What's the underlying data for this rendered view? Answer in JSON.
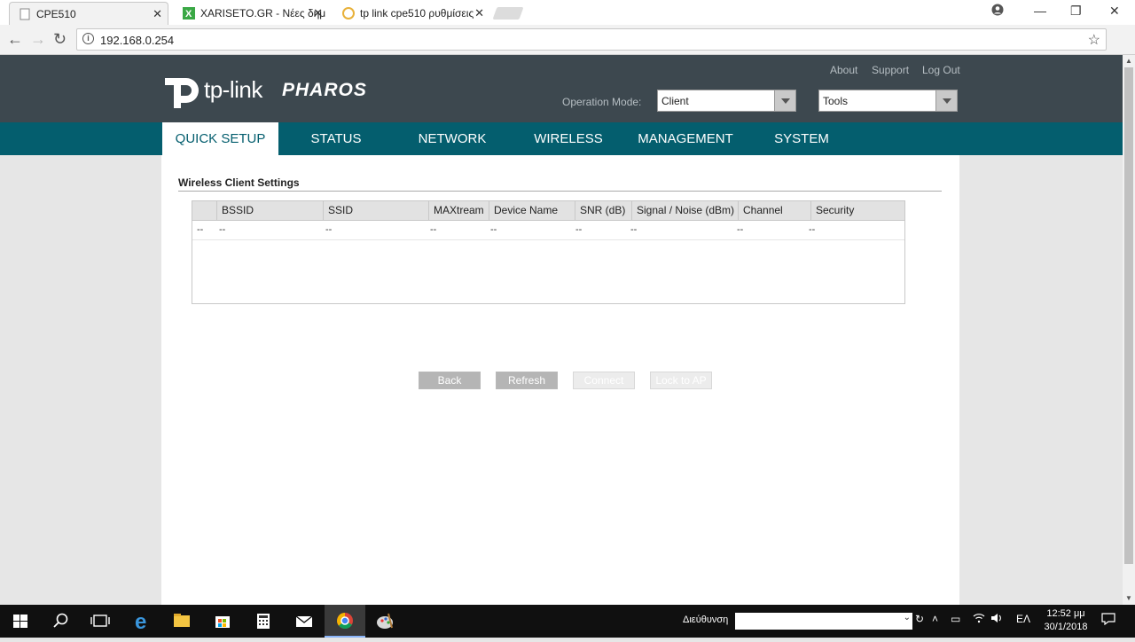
{
  "browser": {
    "tabs": [
      {
        "title": "CPE510"
      },
      {
        "title": "XARISETO.GR - Νέες δημ"
      },
      {
        "title": "tp link cpe510 ρυθμίσεις"
      }
    ],
    "url": "192.168.0.254"
  },
  "header": {
    "brand": "tp-link",
    "product": "PHAROS",
    "links": {
      "about": "About",
      "support": "Support",
      "logout": "Log Out"
    },
    "operation_mode_label": "Operation Mode:",
    "operation_mode_value": "Client",
    "tools_value": "Tools"
  },
  "menu": [
    {
      "label": "QUICK SETUP"
    },
    {
      "label": "STATUS"
    },
    {
      "label": "NETWORK"
    },
    {
      "label": "WIRELESS"
    },
    {
      "label": "MANAGEMENT"
    },
    {
      "label": "SYSTEM"
    }
  ],
  "section": {
    "title": "Wireless Client Settings"
  },
  "table": {
    "columns": [
      "",
      "BSSID",
      "SSID",
      "MAXtream",
      "Device Name",
      "SNR (dB)",
      "Signal / Noise (dBm)",
      "Channel",
      "Security"
    ],
    "row": [
      "--",
      "--",
      "--",
      "--",
      "--",
      "--",
      "--",
      "--",
      "--"
    ]
  },
  "buttons": {
    "back": "Back",
    "refresh": "Refresh",
    "connect": "Connect",
    "lock": "Lock to AP"
  },
  "taskbar": {
    "address_label": "Διεύθυνση",
    "language": "ΕΛ",
    "time": "12:52 μμ",
    "date": "30/1/2018"
  },
  "colors": {
    "header_bg": "#3d484f",
    "menu_bg": "#045e6e",
    "active_menu_text": "#045e6e"
  }
}
